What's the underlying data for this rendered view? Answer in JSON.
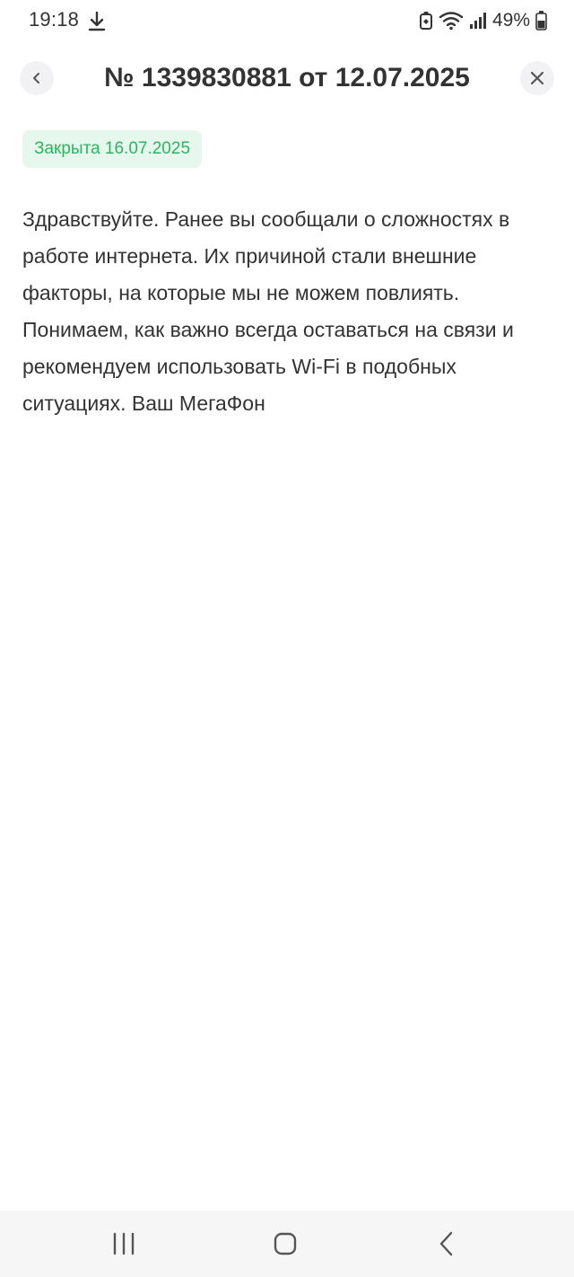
{
  "status_bar": {
    "time": "19:18",
    "battery_percent": "49%",
    "icons": [
      "download-icon",
      "battery-saver-icon",
      "wifi-icon",
      "signal-icon",
      "battery-icon"
    ]
  },
  "header": {
    "title": "№ 1339830881 от 12.07.2025",
    "back_icon": "chevron-left-icon",
    "close_icon": "close-icon"
  },
  "badge": {
    "text": "Закрыта 16.07.2025",
    "color": "#2eb35f",
    "background": "#e6f8ed"
  },
  "message": {
    "text": "Здравствуйте. Ранее вы сообщали о сложностях в работе интернета. Их причиной стали внешние факторы, на которые мы не можем повлиять. Понимаем, как важно всегда оставаться на связи и рекомендуем использовать Wi-Fi в подобных ситуациях. Ваш МегаФон"
  },
  "nav_bar": {
    "buttons": [
      "recents-icon",
      "home-icon",
      "back-icon"
    ]
  }
}
